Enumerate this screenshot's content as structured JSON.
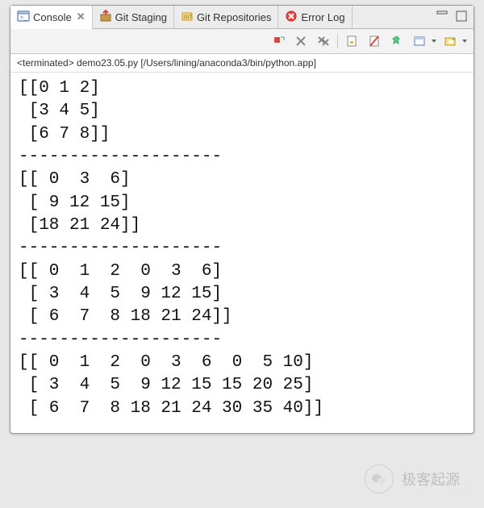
{
  "tabs": {
    "console": "Console",
    "git_staging": "Git Staging",
    "git_repos": "Git Repositories",
    "error_log": "Error Log"
  },
  "status_line": "<terminated> demo23.05.py [/Users/lining/anaconda3/bin/python.app]",
  "console_output": "[[0 1 2]\n [3 4 5]\n [6 7 8]]\n--------------------\n[[ 0  3  6]\n [ 9 12 15]\n [18 21 24]]\n--------------------\n[[ 0  1  2  0  3  6]\n [ 3  4  5  9 12 15]\n [ 6  7  8 18 21 24]]\n--------------------\n[[ 0  1  2  0  3  6  0  5 10]\n [ 3  4  5  9 12 15 15 20 25]\n [ 6  7  8 18 21 24 30 35 40]]",
  "watermark": "极客起源",
  "icons": {
    "console": "console-icon",
    "git_staging": "git-staging-icon",
    "git_repos": "git-repos-icon",
    "error_log": "error-log-icon"
  }
}
